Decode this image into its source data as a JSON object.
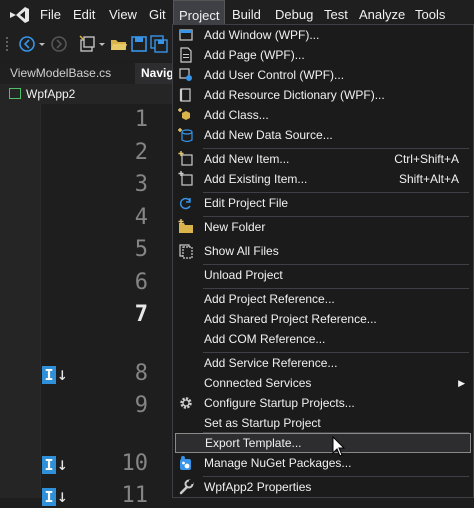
{
  "menubar": {
    "items": [
      "File",
      "Edit",
      "View",
      "Git",
      "Project",
      "Build",
      "Debug",
      "Test",
      "Analyze",
      "Tools"
    ],
    "active": "Project"
  },
  "tabs": [
    "ViewModelBase.cs",
    "Navig"
  ],
  "navbar": {
    "project": "WpfApp2"
  },
  "editor": {
    "line_numbers": [
      "1",
      "2",
      "3",
      "4",
      "5",
      "6",
      "7",
      "8",
      "9",
      "10",
      "11"
    ],
    "current_line": "7"
  },
  "project_menu": {
    "items": [
      {
        "label": "Add Window (WPF)...",
        "icon": "add-window-icon"
      },
      {
        "label": "Add Page (WPF)...",
        "icon": "add-page-icon"
      },
      {
        "label": "Add User Control (WPF)...",
        "icon": "add-user-control-icon"
      },
      {
        "label": "Add Resource Dictionary (WPF)...",
        "icon": "add-resource-dictionary-icon"
      },
      {
        "label": "Add Class...",
        "icon": "add-class-icon"
      },
      {
        "label": "Add New Data Source...",
        "icon": "add-data-source-icon"
      },
      {
        "label": "Add New Item...",
        "shortcut": "Ctrl+Shift+A",
        "icon": "add-new-item-icon"
      },
      {
        "label": "Add Existing Item...",
        "shortcut": "Shift+Alt+A",
        "icon": "add-existing-item-icon"
      },
      {
        "label": "Edit Project File",
        "icon": "edit-project-file-icon"
      },
      {
        "label": "New Folder",
        "icon": "new-folder-icon"
      },
      {
        "label": "Show All Files",
        "icon": "show-all-files-icon"
      },
      {
        "label": "Unload Project",
        "icon": ""
      },
      {
        "label": "Add Project Reference...",
        "icon": ""
      },
      {
        "label": "Add Shared Project Reference...",
        "icon": ""
      },
      {
        "label": "Add COM Reference...",
        "icon": ""
      },
      {
        "label": "Add Service Reference...",
        "icon": ""
      },
      {
        "label": "Connected Services",
        "submenu": true,
        "icon": ""
      },
      {
        "label": "Configure Startup Projects...",
        "icon": "gear-icon"
      },
      {
        "label": "Set as Startup Project",
        "icon": ""
      },
      {
        "label": "Export Template...",
        "icon": ""
      },
      {
        "label": "Manage NuGet Packages...",
        "icon": "nuget-icon"
      },
      {
        "label": "WpfApp2 Properties",
        "icon": "wrench-icon"
      }
    ]
  },
  "colors": {
    "accent": "#2f8fd8",
    "menu_bg": "#1b1b1c",
    "hover": "#2d2d30"
  }
}
